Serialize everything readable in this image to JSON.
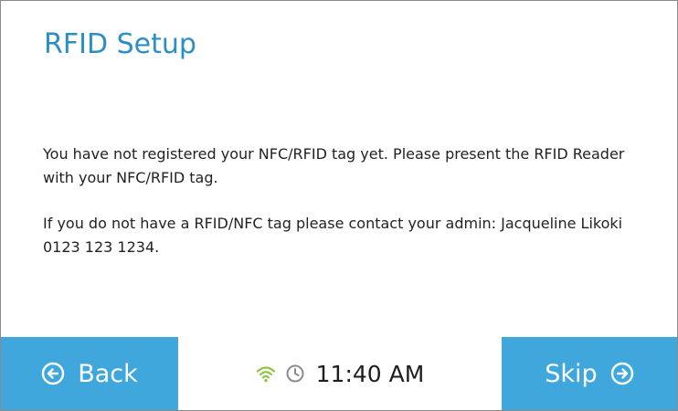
{
  "header": {
    "title": "RFID Setup"
  },
  "content": {
    "message_register": "You have not registered your NFC/RFID tag yet. Please present the RFID Reader with your NFC/RFID tag.",
    "message_contact": "If you do not have a RFID/NFC tag please contact your admin: Jacqueline Likoki 0123 123 1234."
  },
  "footer": {
    "back_label": "Back",
    "back_icon": "arrow-left-circle-icon",
    "skip_label": "Skip",
    "skip_icon": "arrow-right-circle-icon",
    "wifi_icon": "wifi-icon",
    "clock_icon": "clock-icon",
    "time": "11:40 AM"
  },
  "colors": {
    "accent": "#3fa7dc",
    "title": "#2b8fc6",
    "wifi": "#8dc63f",
    "clock_icon": "#8c8c8c"
  }
}
